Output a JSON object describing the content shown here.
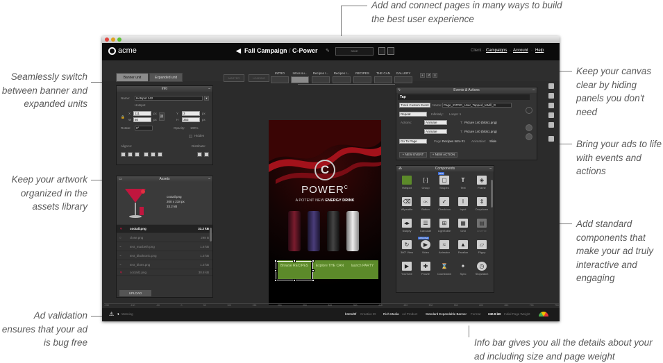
{
  "callouts": {
    "top": "Add and connect pages in many ways to build the best user experience",
    "switch_units": "Seamlessly switch between banner and expanded units",
    "assets": "Keep your artwork organized in the assets library",
    "validation": "Ad validation ensures that your ad is bug free",
    "hide_panels": "Keep your canvas clear by hiding panels you don't need",
    "events": "Bring your ads to life with events and actions",
    "components": "Add standard components that make your ad truly interactive and engaging",
    "infobar": "Info bar gives you all the details about your ad including size and page weight"
  },
  "app": {
    "logo": "acme",
    "campaign": "Fall Campaign",
    "separator": "/",
    "creative": "C-Power",
    "save_label": "SAVE",
    "nav": [
      "Client",
      "Campaigns",
      "Account",
      "Help"
    ],
    "nav_separator": "·"
  },
  "units": {
    "banner": "Banner unit",
    "expanded": "Expanded unit"
  },
  "pages": {
    "ghost": [
      "MASTER",
      "LOADING"
    ],
    "tabs": [
      "INTRO",
      "Intros su...",
      "Recipes I...",
      "Recipes I...",
      "RECIPES",
      "THE CAN",
      "GALLERY"
    ]
  },
  "info_panel": {
    "title": "Info",
    "name_label": "Name:",
    "name_value": "Hotspot 142",
    "hotspot_label": "Hotspot",
    "x_label": "X",
    "x_value": "111",
    "y_label": "Y",
    "y_value": "3",
    "w_label": "W",
    "w_value": "60",
    "h_label": "H",
    "h_value": "353",
    "unit": "px",
    "rotate_label": "Rotate:",
    "rotate_value": "0°",
    "opacity_label": "Opacity:",
    "opacity_value": "100%",
    "hidden_label": "Hidden",
    "align_label": "Align to:",
    "distribute_label": "Distribute:"
  },
  "assets_panel": {
    "title": "Assets",
    "preview_name": "coctail.png",
    "preview_dims": "200 x 218 px",
    "preview_size": "33.2 kB",
    "items": [
      {
        "name": "coctail.png",
        "size": "33.2 kB"
      },
      {
        "name": "close.png",
        "size": "298 B"
      },
      {
        "name": "text_macbeth.png",
        "size": "1.6 kB"
      },
      {
        "name": "text_blacktonic.png",
        "size": "1.3 kB"
      },
      {
        "name": "text_blues.png",
        "size": "1.3 kB"
      },
      {
        "name": "coctail1.png",
        "size": "30.8 kB"
      }
    ],
    "upload_label": "UPLOAD"
  },
  "events_panel": {
    "title": "Events & Actions",
    "group": "Tap",
    "track_event": "Track Custom Event",
    "name_label": "Name:",
    "name_value": "Page_INTRO_User_Tapped_toMill_R",
    "repeat": "Repeat",
    "infinitely": "Infinitely:",
    "loops": "Loops: 1",
    "actions_label": "Actions:",
    "animate": "Animate",
    "t_label": "T:",
    "t_value": "Picture 140 (blob1.png)",
    "goto": "Go To Page",
    "page_label": "Page:",
    "page_value": "Recipes Intro #1",
    "animation_label": "Animation:",
    "animation_value": "Slide",
    "new_event": "+ NEW EVENT",
    "new_action": "+ NEW ACTION"
  },
  "components_panel": {
    "title": "Components",
    "new_badge": "NEW",
    "updated_badge": "UPDATED",
    "items": [
      "Hotspot",
      "Group",
      "Shapes",
      "Text",
      "Frame",
      "Wipeable",
      "Button",
      "Checkbox",
      "Input",
      "Dropdown",
      "Swipey",
      "Carousel",
      "LightTable",
      "Grid",
      "LiveFile",
      "360° View",
      "Video",
      "Animator",
      "Parallax",
      "Flippy",
      "YouTube",
      "Puzzle",
      "Countdown",
      "Sync",
      "Stopwatch"
    ]
  },
  "ad": {
    "logo_letter": "C",
    "brand": "POWER",
    "brand_sup": "C",
    "tagline_a": "A POTENT NEW ",
    "tagline_b": "ENERGY DRINK",
    "ctas": [
      "Browse RECIPES",
      "Explore THE CAN",
      "launch PARTY"
    ]
  },
  "ruler": [
    "-150",
    "-100",
    "-50",
    "0",
    "50",
    "100",
    "150",
    "200",
    "250",
    "300",
    "350",
    "400",
    "450",
    "500",
    "550",
    "600",
    "650",
    "700",
    "750"
  ],
  "bottom": {
    "warnings_count": "1",
    "warnings_label": "Warning",
    "creative_id": "b3e5d9f",
    "creative_id_label": "Creative ID",
    "product": "Rich Media",
    "product_label": "Ad Product",
    "format": "Standard Expandable Banner",
    "format_label": "Format",
    "weight": "240.9 kB",
    "weight_label": "Initial Page Weight"
  },
  "colors": {
    "accent_green": "#5c8a2a",
    "ad_red": "#a3121b",
    "bar_bg": "#0b0b0b"
  }
}
